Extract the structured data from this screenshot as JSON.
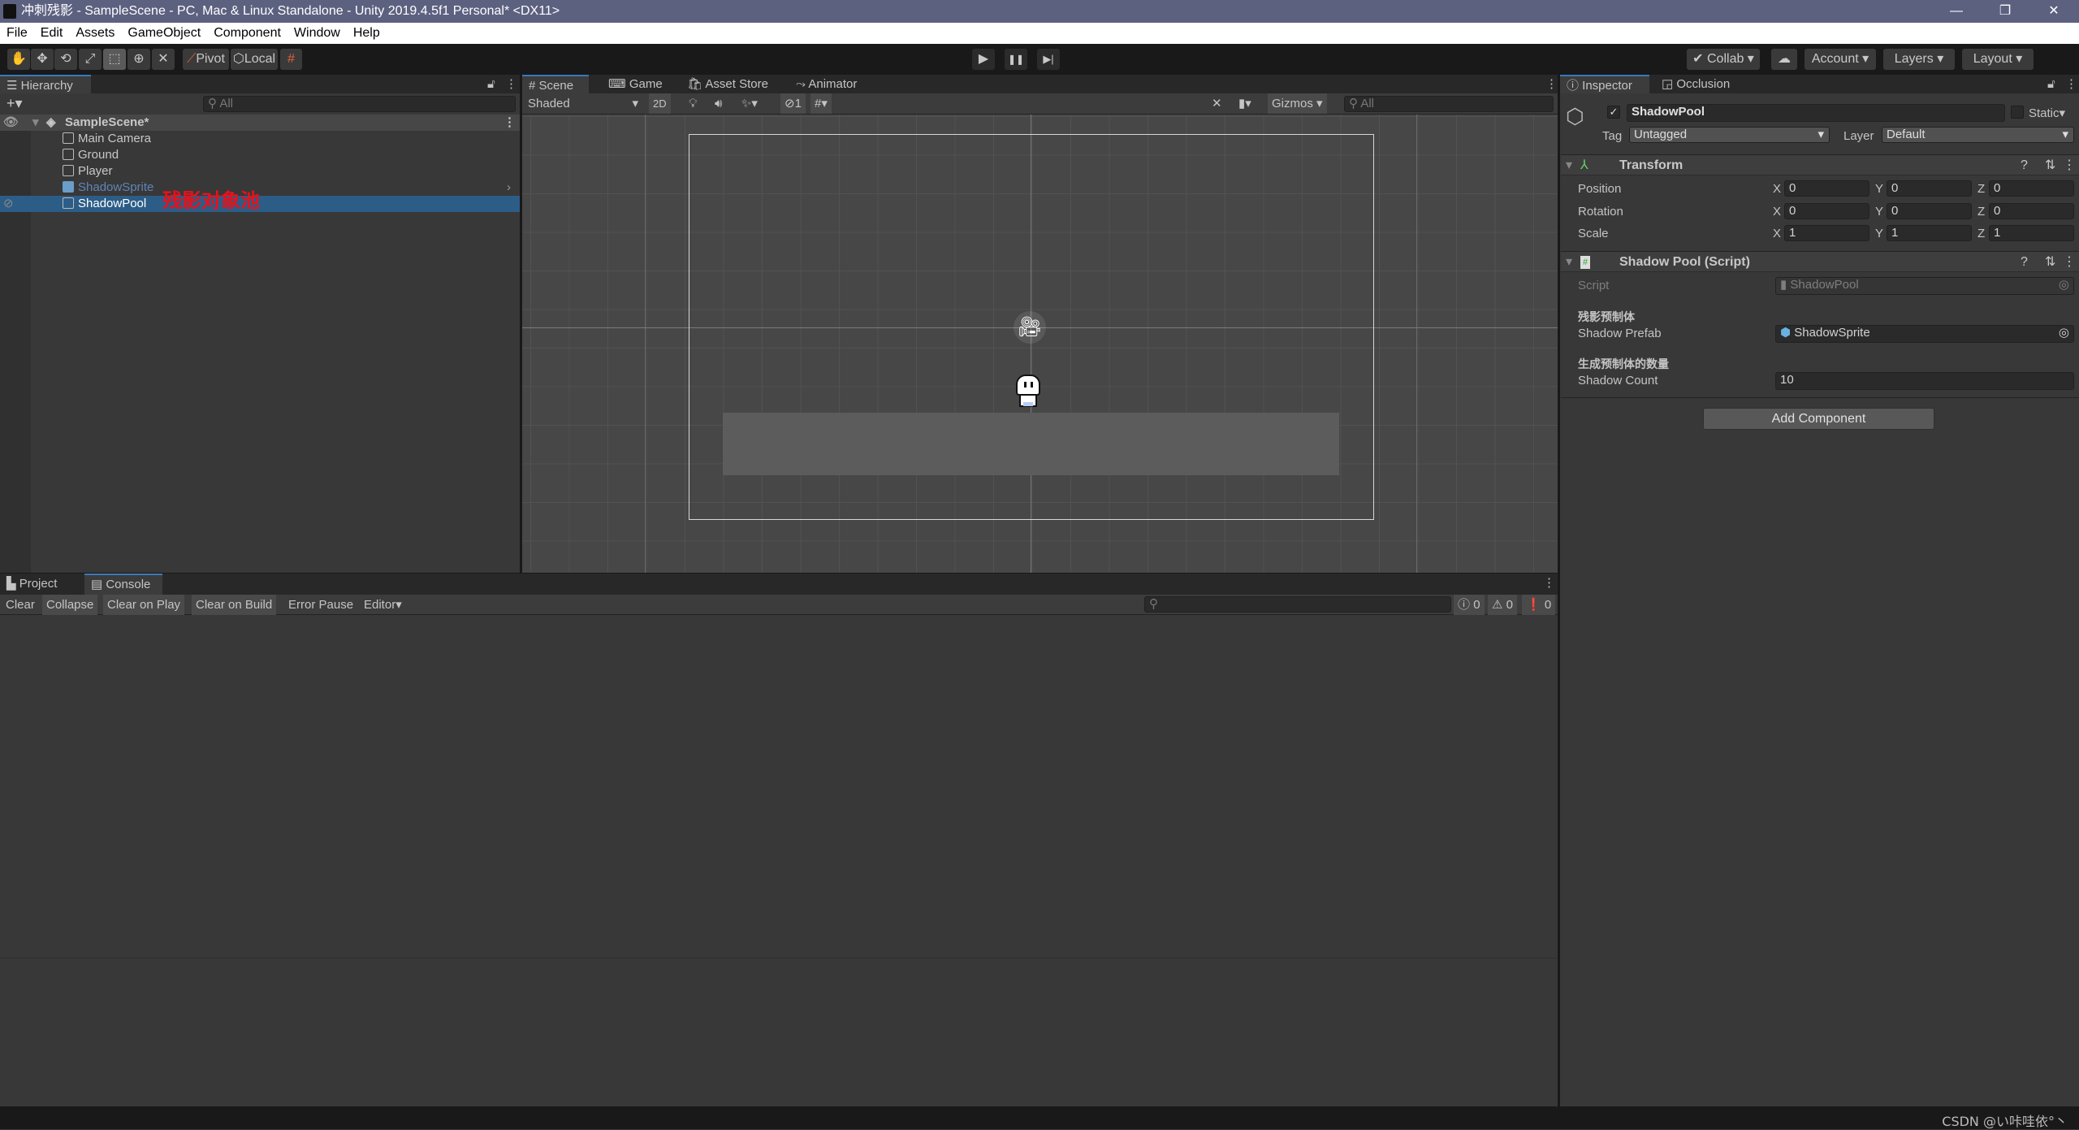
{
  "window": {
    "title": "冲刺残影 - SampleScene - PC, Mac & Linux Standalone - Unity 2019.4.5f1 Personal* <DX11>",
    "minimize": "—",
    "maximize": "❐",
    "close": "✕"
  },
  "menu": [
    "File",
    "Edit",
    "Assets",
    "GameObject",
    "Component",
    "Window",
    "Help"
  ],
  "toolbar": {
    "tools": [
      "hand-tool",
      "move-tool",
      "rotate-tool",
      "scale-tool",
      "rect-tool",
      "transform-tool",
      "custom-tool"
    ],
    "active_tool": "rect-tool",
    "pivot": "Pivot",
    "local": "Local",
    "play": "▶",
    "pause": "❚❚",
    "step": "▶|",
    "collab": "Collab",
    "cloud": "☁",
    "account": "Account",
    "layers": "Layers",
    "layout": "Layout"
  },
  "hierarchy": {
    "tab": "Hierarchy",
    "add": "+▾",
    "search_placeholder": "All",
    "scene": "SampleScene*",
    "items": [
      {
        "label": "Main Camera",
        "type": "gameobject"
      },
      {
        "label": "Ground",
        "type": "gameobject"
      },
      {
        "label": "Player",
        "type": "gameobject"
      },
      {
        "label": "ShadowSprite",
        "type": "prefab"
      },
      {
        "label": "ShadowPool",
        "type": "gameobject",
        "selected": true
      }
    ],
    "annotation": "残影对象池",
    "annotation_color": "#e8111b"
  },
  "scene": {
    "tabs": [
      "Scene",
      "Game",
      "Asset Store",
      "Animator"
    ],
    "active_tab": "Scene",
    "shading": "Shaded",
    "mode_2d": "2D",
    "hidden_count": "1",
    "gizmos": "Gizmos",
    "search_placeholder": "All"
  },
  "inspector": {
    "tabs": [
      "Inspector",
      "Occlusion"
    ],
    "object_name": "ShadowPool",
    "active": true,
    "static_label": "Static",
    "tag_label": "Tag",
    "tag": "Untagged",
    "layer_label": "Layer",
    "layer": "Default",
    "transform": {
      "title": "Transform",
      "rows": [
        {
          "label": "Position",
          "x": "0",
          "y": "0",
          "z": "0"
        },
        {
          "label": "Rotation",
          "x": "0",
          "y": "0",
          "z": "0"
        },
        {
          "label": "Scale",
          "x": "1",
          "y": "1",
          "z": "1"
        }
      ]
    },
    "script_component": {
      "title": "Shadow Pool (Script)",
      "script_label": "Script",
      "script_value": "ShadowPool",
      "header1": "残影预制体",
      "prefab_label": "Shadow Prefab",
      "prefab_value": "ShadowSprite",
      "header2": "生成预制体的数量",
      "count_label": "Shadow Count",
      "count_value": "10"
    },
    "add_component": "Add Component"
  },
  "console": {
    "tabs": [
      "Project",
      "Console"
    ],
    "active_tab": "Console",
    "buttons": [
      "Clear",
      "Collapse",
      "Clear on Play",
      "Clear on Build",
      "Error Pause",
      "Editor"
    ],
    "active_buttons": [
      "Collapse",
      "Clear on Play",
      "Clear on Build"
    ],
    "info_count": "0",
    "warning_count": "0",
    "error_count": "0"
  },
  "watermark": "CSDN @い咔哇依°丶",
  "colors": {
    "selection": "#2c5d87",
    "accent_tab": "#3a79bb",
    "prefab_text": "#5f84b8"
  }
}
